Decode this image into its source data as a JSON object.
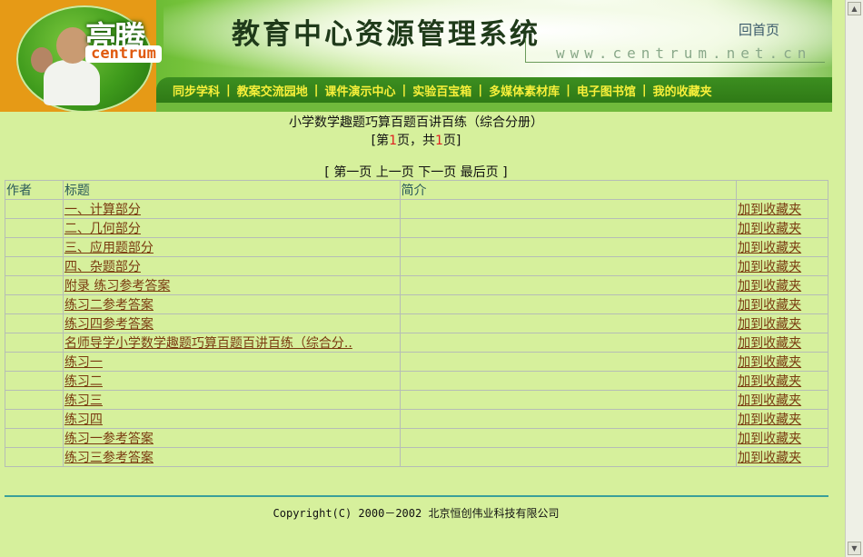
{
  "header": {
    "logo_cn": "亮腾",
    "logo_en": "centrum",
    "system_title": "教育中心资源管理系统",
    "home_link": "回首页",
    "url_text": "www.centrum.net.cn",
    "nav": [
      "同步学科",
      "教案交流园地",
      "课件演示中心",
      "实验百宝箱",
      "多媒体素材库",
      "电子图书馆",
      "我的收藏夹"
    ]
  },
  "book": {
    "title": "小学数学趣题巧算百题百讲百练（综合分册）",
    "page_prefix": "[第",
    "current_page": "1",
    "page_mid": "页，共",
    "total_pages": "1",
    "page_suffix": "页]"
  },
  "pager": {
    "open": "[",
    "first": "第一页",
    "prev": "上一页",
    "next": "下一页",
    "last": "最后页",
    "close": "]"
  },
  "table": {
    "headers": {
      "author": "作者",
      "title": "标题",
      "desc": "简介",
      "fav": ""
    },
    "fav_label": "加到收藏夹",
    "rows": [
      {
        "author": "",
        "title": "一、计算部分",
        "desc": ""
      },
      {
        "author": "",
        "title": "二、几何部分",
        "desc": ""
      },
      {
        "author": "",
        "title": "三、应用题部分",
        "desc": ""
      },
      {
        "author": "",
        "title": "四、杂题部分",
        "desc": ""
      },
      {
        "author": "",
        "title": "附录 练习参考答案",
        "desc": ""
      },
      {
        "author": "",
        "title": "练习二参考答案",
        "desc": ""
      },
      {
        "author": "",
        "title": "练习四参考答案",
        "desc": ""
      },
      {
        "author": "",
        "title": "名师导学小学数学趣题巧算百题百讲百练（综合分..",
        "desc": ""
      },
      {
        "author": "",
        "title": "练习一",
        "desc": ""
      },
      {
        "author": "",
        "title": "练习二",
        "desc": ""
      },
      {
        "author": "",
        "title": "练习三",
        "desc": ""
      },
      {
        "author": "",
        "title": "练习四",
        "desc": ""
      },
      {
        "author": "",
        "title": "练习一参考答案",
        "desc": ""
      },
      {
        "author": "",
        "title": "练习三参考答案",
        "desc": ""
      }
    ]
  },
  "footer": {
    "copyright": "Copyright(C) 2000－2002 北京恒创伟业科技有限公司"
  },
  "colors": {
    "page_bg": "#d6f09c",
    "nav_text": "#f7ef3a",
    "link": "#7a3a10",
    "page_number": "#e02020",
    "footer_rule": "#3aa09a"
  }
}
